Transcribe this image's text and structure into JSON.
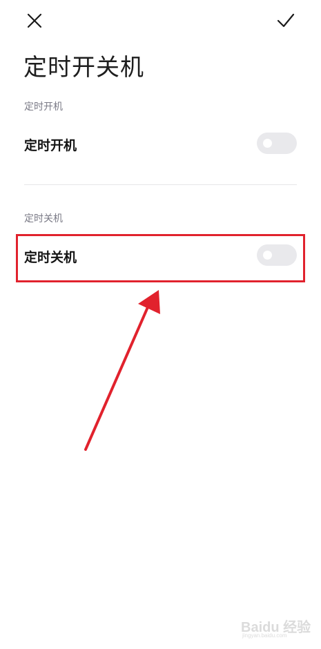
{
  "header": {
    "close_icon": "close-icon",
    "confirm_icon": "check-icon",
    "title": "定时开关机"
  },
  "sections": [
    {
      "header": "定时开机",
      "item_label": "定时开机",
      "toggle_on": false
    },
    {
      "header": "定时关机",
      "item_label": "定时关机",
      "toggle_on": false
    }
  ],
  "annotation": {
    "highlight_color": "#e1222d",
    "arrow_color": "#e1222d"
  },
  "watermark": {
    "brand": "Baidu 经验",
    "url": "jingyan.baidu.com"
  },
  "colors": {
    "toggle_off": "#e9e9ec",
    "section_header": "#7a7a86"
  }
}
